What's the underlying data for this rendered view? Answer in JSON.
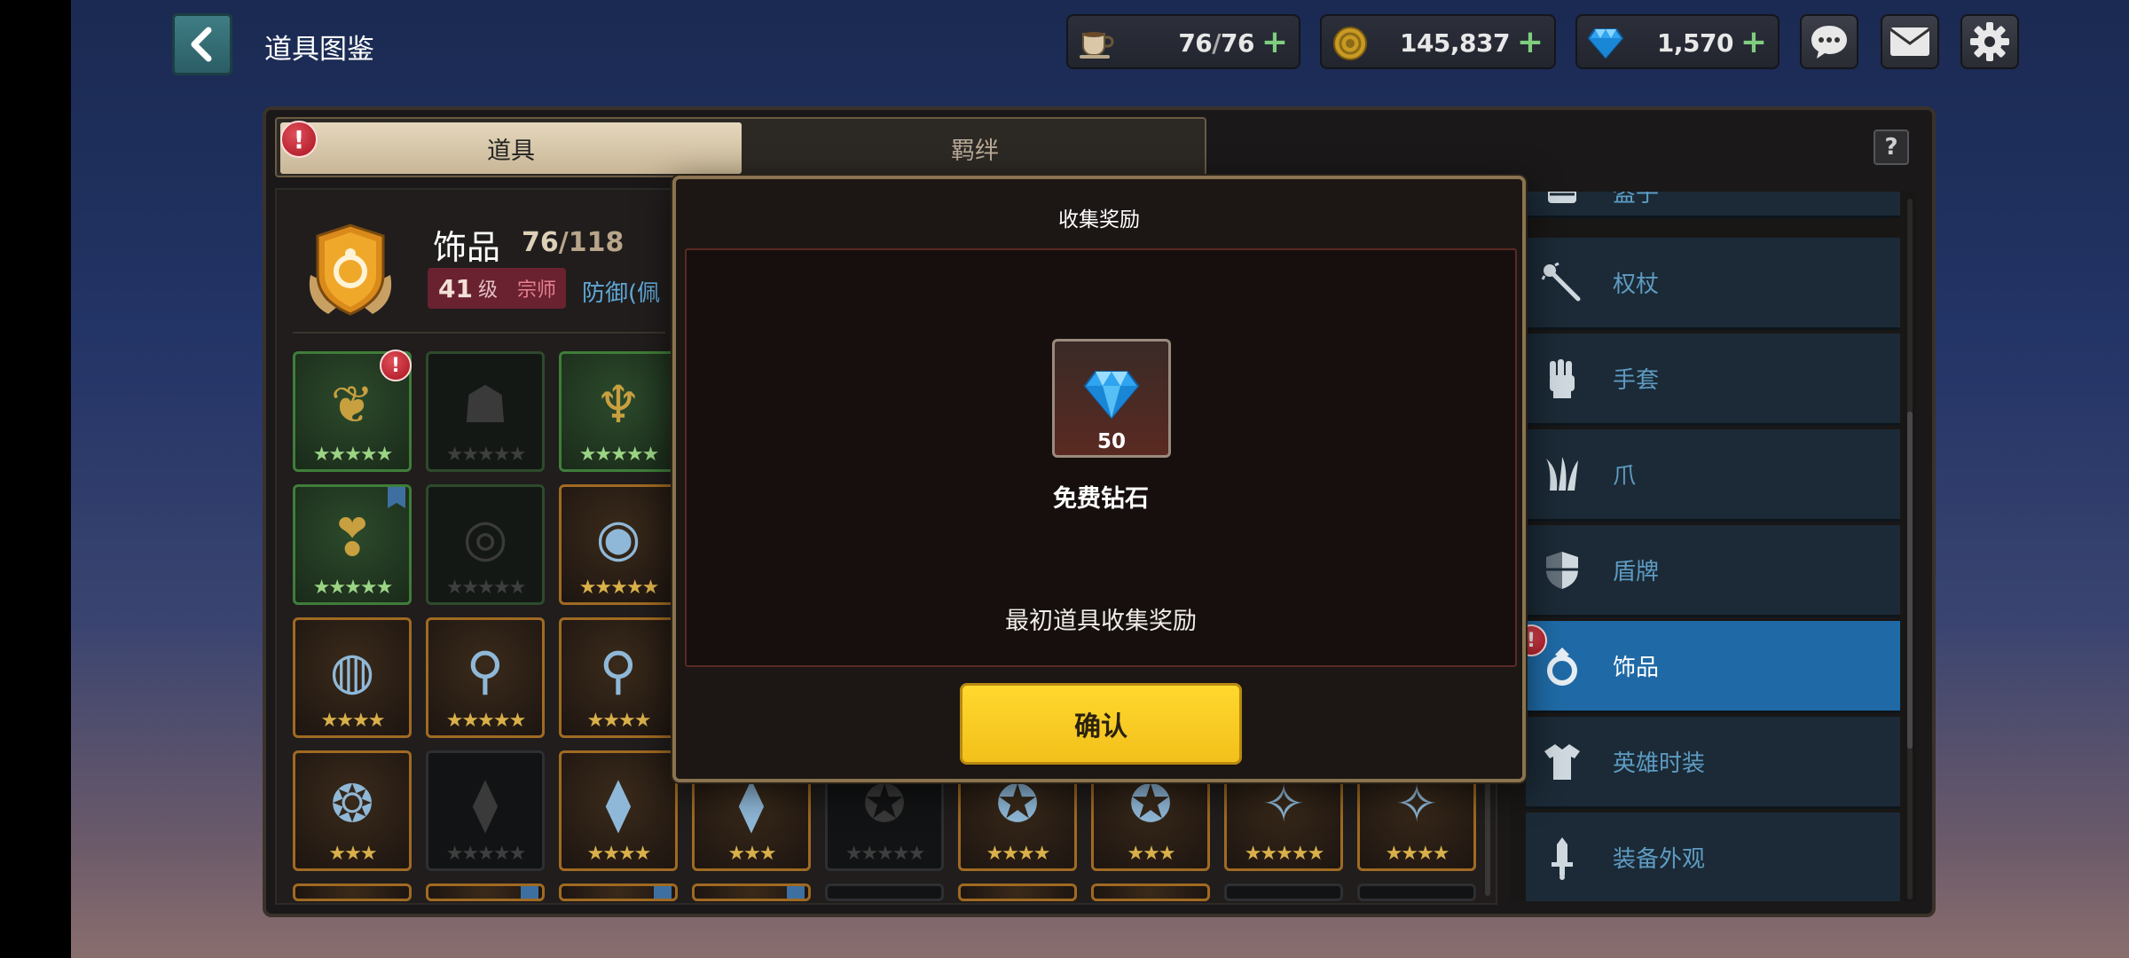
{
  "header": {
    "title": "道具图鉴",
    "resources": [
      {
        "name": "stamina",
        "icon": "coffee-cup-icon",
        "current": "76",
        "max": "76"
      },
      {
        "name": "gold",
        "icon": "gold-coin-icon",
        "value": "145,837"
      },
      {
        "name": "diamond",
        "icon": "diamond-icon",
        "value": "1,570"
      }
    ]
  },
  "tabs": {
    "items": "道具",
    "bonds": "羁绊",
    "help": "?"
  },
  "category": {
    "name": "饰品",
    "collected": "76",
    "total": "118",
    "level": "41",
    "level_unit": "级",
    "rank": "宗师",
    "stat_preview": "防御(佩"
  },
  "grid_rows": [
    [
      {
        "style": "green",
        "glyph": "❦",
        "stars": "★★★★★",
        "star_color": "g",
        "alert": true
      },
      {
        "style": "dimgreen",
        "glyph": "☗",
        "stars": "★★★★★",
        "star_color": "d"
      },
      {
        "style": "green",
        "glyph": "♆",
        "stars": "★★★★★",
        "star_color": "g"
      }
    ],
    [
      {
        "style": "green",
        "glyph": "❣",
        "stars": "★★★★★",
        "star_color": "g",
        "bookmark": true
      },
      {
        "style": "dimgreen",
        "glyph": "◎",
        "stars": "★★★★★",
        "star_color": "d"
      },
      {
        "style": "gold",
        "glyph": "◉",
        "stars": "★★★★★",
        "star_color": "y"
      }
    ],
    [
      {
        "style": "gold",
        "glyph": "◍",
        "stars": "★★★★",
        "star_color": "y"
      },
      {
        "style": "gold",
        "glyph": "⚲",
        "stars": "★★★★★",
        "star_color": "y"
      },
      {
        "style": "gold",
        "glyph": "⚲",
        "stars": "★★★★",
        "star_color": "y"
      }
    ],
    [
      {
        "style": "gold",
        "glyph": "❂",
        "stars": "★★★",
        "star_color": "y"
      },
      {
        "style": "dark",
        "glyph": "⧫",
        "stars": "★★★★★",
        "star_color": "d"
      },
      {
        "style": "gold",
        "glyph": "⧫",
        "stars": "★★★★",
        "star_color": "y"
      },
      {
        "style": "gold",
        "glyph": "⧫",
        "stars": "★★★",
        "star_color": "y"
      },
      {
        "style": "dark",
        "glyph": "✪",
        "stars": "★★★★★",
        "star_color": "d"
      },
      {
        "style": "gold",
        "glyph": "✪",
        "stars": "★★★★",
        "star_color": "y"
      },
      {
        "style": "gold",
        "glyph": "✪",
        "stars": "★★★",
        "star_color": "y"
      },
      {
        "style": "gold",
        "glyph": "✧",
        "stars": "★★★★★",
        "star_color": "y"
      },
      {
        "style": "gold",
        "glyph": "✧",
        "stars": "★★★★",
        "star_color": "y"
      }
    ]
  ],
  "sidebar": {
    "items": [
      {
        "label": "盔子",
        "icon": "helmet-icon"
      },
      {
        "label": "权杖",
        "icon": "scepter-icon"
      },
      {
        "label": "手套",
        "icon": "glove-icon"
      },
      {
        "label": "爪",
        "icon": "claw-icon"
      },
      {
        "label": "盾牌",
        "icon": "shield-icon"
      },
      {
        "label": "饰品",
        "icon": "ring-icon",
        "active": true
      },
      {
        "label": "英雄时装",
        "icon": "costume-icon"
      },
      {
        "label": "装备外观",
        "icon": "equipment-skin-icon"
      }
    ]
  },
  "modal": {
    "title": "收集奖励",
    "reward_qty": "50",
    "reward_name": "免费钻石",
    "reward_desc": "最初道具收集奖励",
    "confirm": "确认"
  },
  "colors": {
    "accent_yellow": "#f2c01a",
    "active_blue": "#1f6aa6",
    "alert_red": "#c41e2c",
    "plus_green": "#7fce7f"
  }
}
